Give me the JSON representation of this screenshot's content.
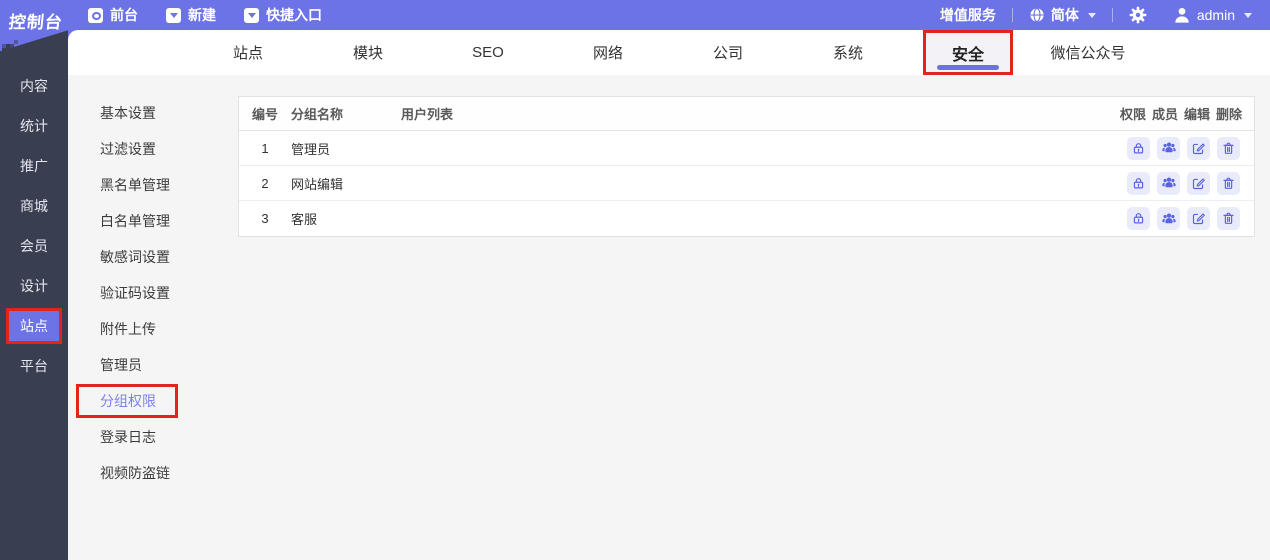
{
  "topbar": {
    "logo": "控制台",
    "menu": [
      {
        "label": "前台",
        "icon": "eye-icon"
      },
      {
        "label": "新建",
        "icon": "caret-down-icon"
      },
      {
        "label": "快捷入口",
        "icon": "caret-down-icon"
      }
    ],
    "vas": "增值服务",
    "language": "简体",
    "username": "admin"
  },
  "sidebar": {
    "items": [
      "内容",
      "统计",
      "推广",
      "商城",
      "会员",
      "设计",
      "站点",
      "平台"
    ],
    "active": "站点",
    "active_index": 6
  },
  "tabs": {
    "items": [
      "站点",
      "模块",
      "SEO",
      "网络",
      "公司",
      "系统",
      "安全",
      "微信公众号"
    ],
    "active": "安全",
    "active_index": 6
  },
  "submenu": {
    "items": [
      "基本设置",
      "过滤设置",
      "黑名单管理",
      "白名单管理",
      "敏感词设置",
      "验证码设置",
      "附件上传",
      "管理员",
      "分组权限",
      "登录日志",
      "视频防盗链"
    ],
    "active": "分组权限",
    "active_index": 8
  },
  "table": {
    "columns": {
      "id": "编号",
      "name": "分组名称",
      "users": "用户列表"
    },
    "action_columns": [
      "权限",
      "成员",
      "编辑",
      "删除"
    ],
    "rows": [
      {
        "id": "1",
        "name": "管理员",
        "users": ""
      },
      {
        "id": "2",
        "name": "网站编辑",
        "users": ""
      },
      {
        "id": "3",
        "name": "客服",
        "users": ""
      }
    ]
  },
  "icons": {
    "eye-icon": "white square with circle",
    "caret-down-icon": "▼",
    "globe-icon": "globe",
    "gear-icon": "⚙",
    "user-icon": "person silhouette",
    "lock-icon": "padlock outline",
    "group-icon": "three people filled",
    "edit-icon": "square with pencil",
    "trash-icon": "trash can outline"
  },
  "colors": {
    "accent": "#6b73e6",
    "sidebar_bg": "#3a3e51",
    "annotation_red": "#e1251b",
    "action_icon": "#5a64e0",
    "action_icon_bg": "#e9ebfb",
    "content_bg": "#f5f5f6"
  }
}
